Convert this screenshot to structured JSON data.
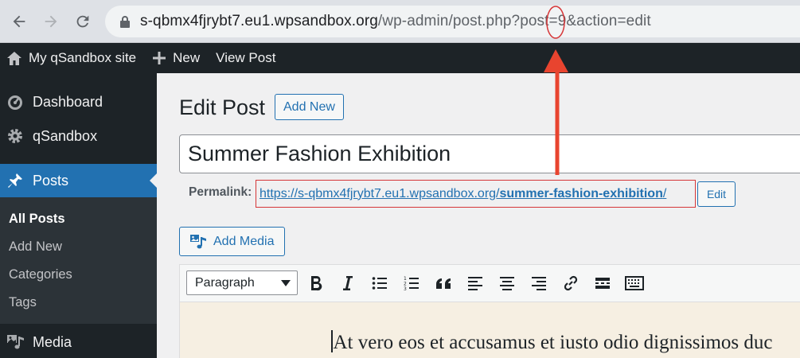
{
  "browser": {
    "url_host": "s-qbmx4fjrybt7.eu1.wpsandbox.org",
    "url_path_prefix": "/wp-admin/post.php?post=",
    "url_post_id": "9",
    "url_suffix": "&action=edit"
  },
  "admin_bar": {
    "site_name": "My qSandbox site",
    "new_label": "New",
    "view_post_label": "View Post"
  },
  "sidebar": {
    "dashboard": "Dashboard",
    "qsandbox": "qSandbox",
    "posts": "Posts",
    "submenu": [
      "All Posts",
      "Add New",
      "Categories",
      "Tags"
    ],
    "media": "Media"
  },
  "main": {
    "page_title": "Edit Post",
    "add_new_label": "Add New",
    "post_title": "Summer Fashion Exhibition",
    "permalink_label": "Permalink:",
    "permalink_base": "https://s-qbmx4fjrybt7.eu1.wpsandbox.org/",
    "permalink_slug": "summer-fashion-exhibition",
    "permalink_trailing": "/",
    "edit_label": "Edit",
    "add_media_label": "Add Media",
    "format_select_value": "Paragraph",
    "editor_text": "At vero eos et accusamus et iusto odio dignissimos duc"
  },
  "colors": {
    "admin_dark": "#1d2327",
    "accent_blue": "#2271b1",
    "annotation_red": "#d63638"
  }
}
